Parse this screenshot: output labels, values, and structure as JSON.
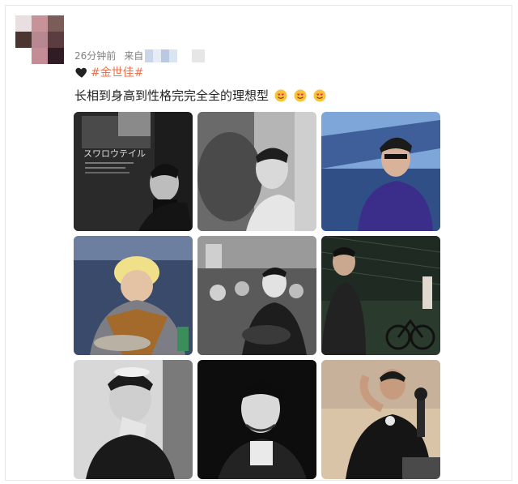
{
  "post": {
    "time": "26分钟前",
    "from_label": "来自",
    "topic": "#金世佳#",
    "text": "长相到身高到性格完完全全的理想型",
    "emoji_count": 3
  },
  "photos": [
    {
      "id": "p1",
      "poster_title": "スワロウテイル"
    },
    {
      "id": "p2"
    },
    {
      "id": "p3"
    },
    {
      "id": "p4"
    },
    {
      "id": "p5"
    },
    {
      "id": "p6"
    },
    {
      "id": "p7"
    },
    {
      "id": "p8"
    },
    {
      "id": "p9"
    }
  ],
  "colors": {
    "topic": "#eb7350",
    "meta": "#808080",
    "text": "#222222",
    "heart": "#222222"
  },
  "icons": [
    "black-heart-icon",
    "heart-eyes-emoji-icon"
  ]
}
